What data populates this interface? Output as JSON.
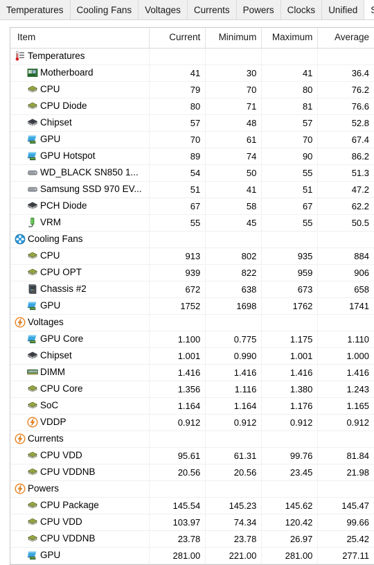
{
  "tabs": [
    {
      "label": "Temperatures",
      "active": false
    },
    {
      "label": "Cooling Fans",
      "active": false
    },
    {
      "label": "Voltages",
      "active": false
    },
    {
      "label": "Currents",
      "active": false
    },
    {
      "label": "Powers",
      "active": false
    },
    {
      "label": "Clocks",
      "active": false
    },
    {
      "label": "Unified",
      "active": false
    },
    {
      "label": "Sta",
      "active": true
    }
  ],
  "table": {
    "columns": [
      "Item",
      "Current",
      "Minimum",
      "Maximum",
      "Average"
    ],
    "rows": [
      {
        "kind": "group",
        "icon": "thermometer-icon",
        "label": "Temperatures",
        "current": "",
        "minimum": "",
        "maximum": "",
        "average": ""
      },
      {
        "kind": "child",
        "icon": "motherboard-icon",
        "label": "Motherboard",
        "current": "41",
        "minimum": "30",
        "maximum": "41",
        "average": "36.4"
      },
      {
        "kind": "child",
        "icon": "cpu-icon",
        "label": "CPU",
        "current": "79",
        "minimum": "70",
        "maximum": "80",
        "average": "76.2"
      },
      {
        "kind": "child",
        "icon": "cpu-icon",
        "label": "CPU Diode",
        "current": "80",
        "minimum": "71",
        "maximum": "81",
        "average": "76.6"
      },
      {
        "kind": "child",
        "icon": "chipset-icon",
        "label": "Chipset",
        "current": "57",
        "minimum": "48",
        "maximum": "57",
        "average": "52.8"
      },
      {
        "kind": "child",
        "icon": "gpu-icon",
        "label": "GPU",
        "current": "70",
        "minimum": "61",
        "maximum": "70",
        "average": "67.4"
      },
      {
        "kind": "child",
        "icon": "gpu-icon",
        "label": "GPU Hotspot",
        "current": "89",
        "minimum": "74",
        "maximum": "90",
        "average": "86.2"
      },
      {
        "kind": "child",
        "icon": "drive-icon",
        "label": "WD_BLACK SN850 1...",
        "current": "54",
        "minimum": "50",
        "maximum": "55",
        "average": "51.3"
      },
      {
        "kind": "child",
        "icon": "drive-icon",
        "label": "Samsung SSD 970 EV...",
        "current": "51",
        "minimum": "41",
        "maximum": "51",
        "average": "47.2"
      },
      {
        "kind": "child",
        "icon": "chipset-icon",
        "label": "PCH Diode",
        "current": "67",
        "minimum": "58",
        "maximum": "67",
        "average": "62.2"
      },
      {
        "kind": "child",
        "icon": "vrm-icon",
        "label": "VRM",
        "current": "55",
        "minimum": "45",
        "maximum": "55",
        "average": "50.5"
      },
      {
        "kind": "group",
        "icon": "fan-icon",
        "label": "Cooling Fans",
        "current": "",
        "minimum": "",
        "maximum": "",
        "average": ""
      },
      {
        "kind": "child",
        "icon": "cpu-icon",
        "label": "CPU",
        "current": "913",
        "minimum": "802",
        "maximum": "935",
        "average": "884"
      },
      {
        "kind": "child",
        "icon": "cpu-icon",
        "label": "CPU OPT",
        "current": "939",
        "minimum": "822",
        "maximum": "959",
        "average": "906"
      },
      {
        "kind": "child",
        "icon": "chassis-icon",
        "label": "Chassis #2",
        "current": "672",
        "minimum": "638",
        "maximum": "673",
        "average": "658"
      },
      {
        "kind": "child",
        "icon": "gpu-icon",
        "label": "GPU",
        "current": "1752",
        "minimum": "1698",
        "maximum": "1762",
        "average": "1741"
      },
      {
        "kind": "group",
        "icon": "bolt-icon",
        "label": "Voltages",
        "current": "",
        "minimum": "",
        "maximum": "",
        "average": ""
      },
      {
        "kind": "child",
        "icon": "gpu-icon",
        "label": "GPU Core",
        "current": "1.100",
        "minimum": "0.775",
        "maximum": "1.175",
        "average": "1.110"
      },
      {
        "kind": "child",
        "icon": "chipset-icon",
        "label": "Chipset",
        "current": "1.001",
        "minimum": "0.990",
        "maximum": "1.001",
        "average": "1.000"
      },
      {
        "kind": "child",
        "icon": "dimm-icon",
        "label": "DIMM",
        "current": "1.416",
        "minimum": "1.416",
        "maximum": "1.416",
        "average": "1.416"
      },
      {
        "kind": "child",
        "icon": "cpu-icon",
        "label": "CPU Core",
        "current": "1.356",
        "minimum": "1.116",
        "maximum": "1.380",
        "average": "1.243"
      },
      {
        "kind": "child",
        "icon": "cpu-icon",
        "label": "SoC",
        "current": "1.164",
        "minimum": "1.164",
        "maximum": "1.176",
        "average": "1.165"
      },
      {
        "kind": "child",
        "icon": "bolt-icon",
        "label": "VDDP",
        "current": "0.912",
        "minimum": "0.912",
        "maximum": "0.912",
        "average": "0.912"
      },
      {
        "kind": "group",
        "icon": "bolt-icon",
        "label": "Currents",
        "current": "",
        "minimum": "",
        "maximum": "",
        "average": ""
      },
      {
        "kind": "child",
        "icon": "cpu-icon",
        "label": "CPU VDD",
        "current": "95.61",
        "minimum": "61.31",
        "maximum": "99.76",
        "average": "81.84"
      },
      {
        "kind": "child",
        "icon": "cpu-icon",
        "label": "CPU VDDNB",
        "current": "20.56",
        "minimum": "20.56",
        "maximum": "23.45",
        "average": "21.98"
      },
      {
        "kind": "group",
        "icon": "bolt-icon",
        "label": "Powers",
        "current": "",
        "minimum": "",
        "maximum": "",
        "average": ""
      },
      {
        "kind": "child",
        "icon": "cpu-icon",
        "label": "CPU Package",
        "current": "145.54",
        "minimum": "145.23",
        "maximum": "145.62",
        "average": "145.47"
      },
      {
        "kind": "child",
        "icon": "cpu-icon",
        "label": "CPU VDD",
        "current": "103.97",
        "minimum": "74.34",
        "maximum": "120.42",
        "average": "99.66"
      },
      {
        "kind": "child",
        "icon": "cpu-icon",
        "label": "CPU VDDNB",
        "current": "23.78",
        "minimum": "23.78",
        "maximum": "26.97",
        "average": "25.42"
      },
      {
        "kind": "child",
        "icon": "gpu-icon",
        "label": "GPU",
        "current": "281.00",
        "minimum": "221.00",
        "maximum": "281.00",
        "average": "277.11"
      }
    ]
  },
  "colors": {
    "tab_bar_bg": "#f0f0f0",
    "tab_active_bg": "#ffffff",
    "grid_border": "#c8c8c8",
    "row_line": "#f0f0f0",
    "accent_orange": "#e8821e",
    "accent_blue": "#2a96d8",
    "accent_green": "#2e8b3d",
    "text": "#1a1a1a"
  }
}
